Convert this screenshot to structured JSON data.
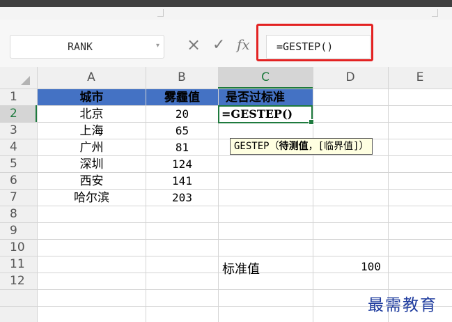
{
  "name_box": {
    "value": "RANK",
    "arrow": "▾"
  },
  "formula_bar": {
    "cancel_icon": "×",
    "enter_icon": "✓",
    "fx_label": "fx",
    "formula": "=GESTEP()"
  },
  "columns": [
    "A",
    "B",
    "C",
    "D",
    "E"
  ],
  "rows": [
    "1",
    "2",
    "3",
    "4",
    "5",
    "6",
    "7",
    "8",
    "9",
    "10",
    "11",
    "12"
  ],
  "table": {
    "headers": [
      "城市",
      "雾霾值",
      "是否过标准"
    ],
    "data": [
      {
        "city": "北京",
        "value": "20"
      },
      {
        "city": "上海",
        "value": "65"
      },
      {
        "city": "广州",
        "value": "81"
      },
      {
        "city": "深圳",
        "value": "124"
      },
      {
        "city": "西安",
        "value": "141"
      },
      {
        "city": "哈尔滨",
        "value": "203"
      }
    ]
  },
  "active_cell": {
    "ref": "C2",
    "content": "=GESTEP()"
  },
  "tooltip": {
    "func": "GESTEP",
    "open": "（",
    "arg1": "待测值",
    "sep": "，",
    "arg2": "[临界值]",
    "close": "）"
  },
  "standard": {
    "label": "标准值",
    "value": "100"
  },
  "watermark": "最需教育",
  "colors": {
    "accent": "#1e7a3e",
    "header_fill": "#4472c4",
    "highlight": "#e32222",
    "watermark": "#1f3c9e"
  }
}
